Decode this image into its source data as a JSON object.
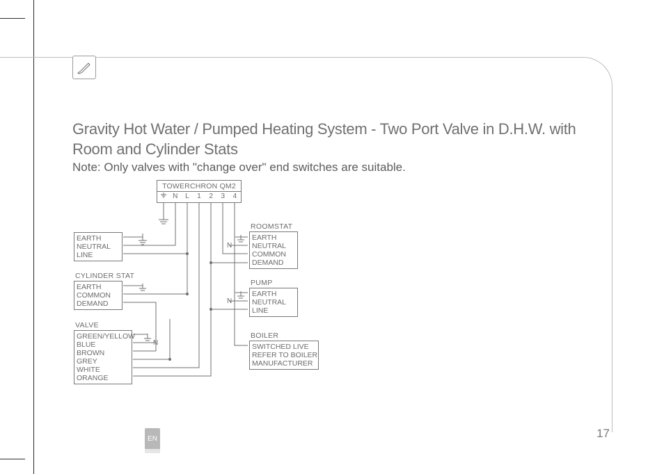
{
  "page": {
    "title": "Gravity Hot Water / Pumped Heating System - Two Port Valve in D.H.W. with Room and Cylinder Stats",
    "note": "Note: Only valves with \"change over\" end switches are suitable.",
    "number": "17",
    "lang": "EN"
  },
  "controller": {
    "name": "TOWERCHRON QM2",
    "terminals": [
      "⏚",
      "N",
      "L",
      "1",
      "2",
      "3",
      "4"
    ]
  },
  "blocks": {
    "supply": {
      "lines": [
        "EARTH",
        "NEUTRAL",
        "LINE"
      ]
    },
    "cylinder_stat": {
      "label": "CYLINDER STAT",
      "lines": [
        "EARTH",
        "COMMON",
        "DEMAND"
      ]
    },
    "valve": {
      "label": "VALVE",
      "lines": [
        "GREEN/YELLOW",
        "BLUE",
        "BROWN",
        "GREY",
        "WHITE",
        "ORANGE"
      ]
    },
    "roomstat": {
      "label": "ROOMSTAT",
      "lines": [
        "EARTH",
        "NEUTRAL",
        "COMMON",
        "DEMAND"
      ]
    },
    "pump": {
      "label": "PUMP",
      "lines": [
        "EARTH",
        "NEUTRAL",
        "LINE"
      ]
    },
    "boiler": {
      "label": "BOILER",
      "lines": [
        "SWITCHED LIVE",
        "REFER TO BOILER",
        "MANUFACTURER"
      ]
    }
  },
  "n_labels": {
    "roomstat_n": "N",
    "pump_n": "N",
    "valve_n": "N"
  }
}
